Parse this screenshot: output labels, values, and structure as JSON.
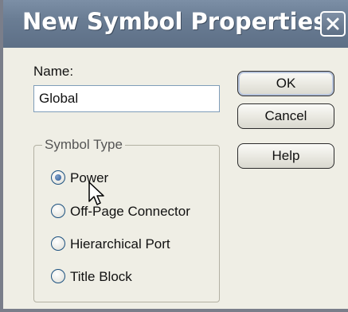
{
  "window": {
    "title": "New Symbol Properties"
  },
  "name_field": {
    "label": "Name:",
    "value": "Global"
  },
  "buttons": {
    "ok": "OK",
    "cancel": "Cancel",
    "help": "Help"
  },
  "symbol_type": {
    "legend": "Symbol Type",
    "selected": "Power",
    "options": [
      {
        "label": "Power",
        "checked": true
      },
      {
        "label": "Off-Page Connector",
        "checked": false
      },
      {
        "label": "Hierarchical Port",
        "checked": false
      },
      {
        "label": "Title Block",
        "checked": false
      }
    ]
  },
  "icons": {
    "close": "close-icon",
    "cursor": "mouse-pointer-icon"
  }
}
